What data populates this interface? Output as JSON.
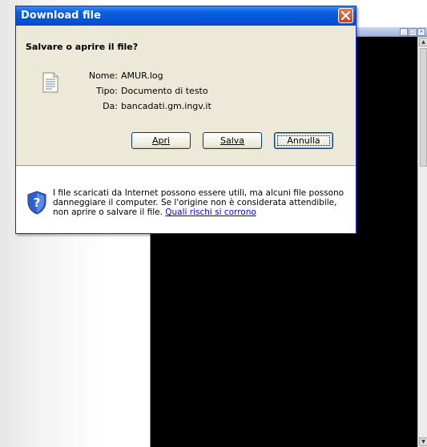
{
  "dialog": {
    "title": "Download file",
    "question": "Salvare o aprire il file?",
    "fields": [
      {
        "label": "Nome:",
        "value": "AMUR.log"
      },
      {
        "label": "Tipo:",
        "value": "Documento di testo"
      },
      {
        "label": "Da:",
        "value": "bancadati.gm.ingv.it"
      }
    ],
    "buttons": {
      "open": "Apri",
      "save": "Salva",
      "cancel": "Annulla"
    },
    "warning": {
      "text": "I file scaricati da Internet possono essere utili, ma alcuni file possono danneggiare il computer. Se l'origine non è considerata attendibile, non aprire o salvare il file.",
      "link": "Quali rischi si corrono"
    },
    "close_icon": "close-icon",
    "file_icon": "text-file-icon",
    "warning_icon": "security-shield-icon"
  },
  "colors": {
    "title_bar": "#0a5fe0",
    "dialog_bg": "#ece9d8",
    "link": "#0000ee",
    "console_bg": "#000000"
  }
}
